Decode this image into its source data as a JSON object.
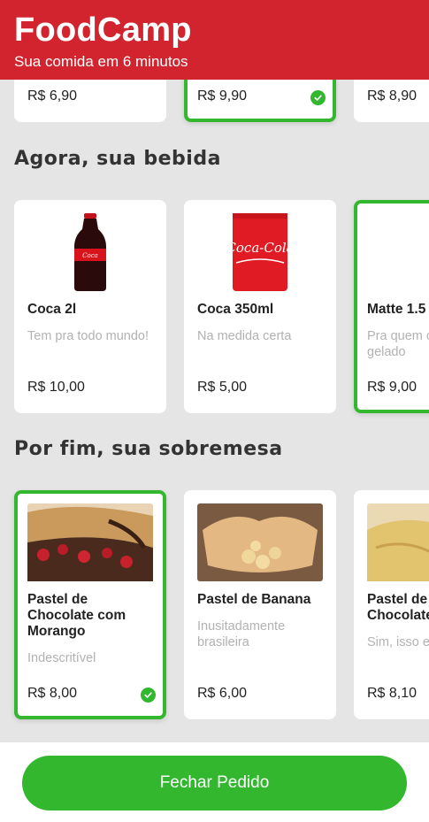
{
  "app": {
    "title": "FoodCamp",
    "subtitle": "Sua comida em 6 minutos"
  },
  "meals": [
    {
      "price": "R$ 6,90",
      "selected": false
    },
    {
      "price": "R$ 9,90",
      "selected": true
    },
    {
      "price": "R$ 8,90",
      "selected": false
    }
  ],
  "drinks_section": {
    "title": "Agora, sua bebida",
    "items": [
      {
        "name": "Coca 2l",
        "description": "Tem pra todo mundo!",
        "price": "R$ 10,00",
        "selected": false,
        "image": "coca-2l-bottle"
      },
      {
        "name": "Coca 350ml",
        "description": "Na medida certa",
        "price": "R$ 5,00",
        "selected": false,
        "image": "coca-can"
      },
      {
        "name": "Matte 1.5",
        "description": "Pra quem c cha gelado",
        "price": "R$ 9,00",
        "selected": true,
        "image": "matte-bottle"
      }
    ]
  },
  "desserts_section": {
    "title": "Por fim, sua sobremesa",
    "items": [
      {
        "name": "Pastel de Chocolate com Morango",
        "description": "Indescritível",
        "price": "R$ 8,00",
        "selected": true,
        "image": "pastel-chocolate-morango"
      },
      {
        "name": "Pastel de Banana",
        "description": "Inusitadamente brasileira",
        "price": "R$ 6,00",
        "selected": false,
        "image": "pastel-banana"
      },
      {
        "name": "Pastel de Chocolate",
        "description": "Sim, isso e",
        "price": "R$ 8,10",
        "selected": false,
        "image": "pastel-chocolate"
      }
    ]
  },
  "footer": {
    "button_label": "Fechar Pedido"
  },
  "colors": {
    "brand_red": "#d1242f",
    "accent_green": "#32b72f",
    "background": "#e5e5e5"
  }
}
